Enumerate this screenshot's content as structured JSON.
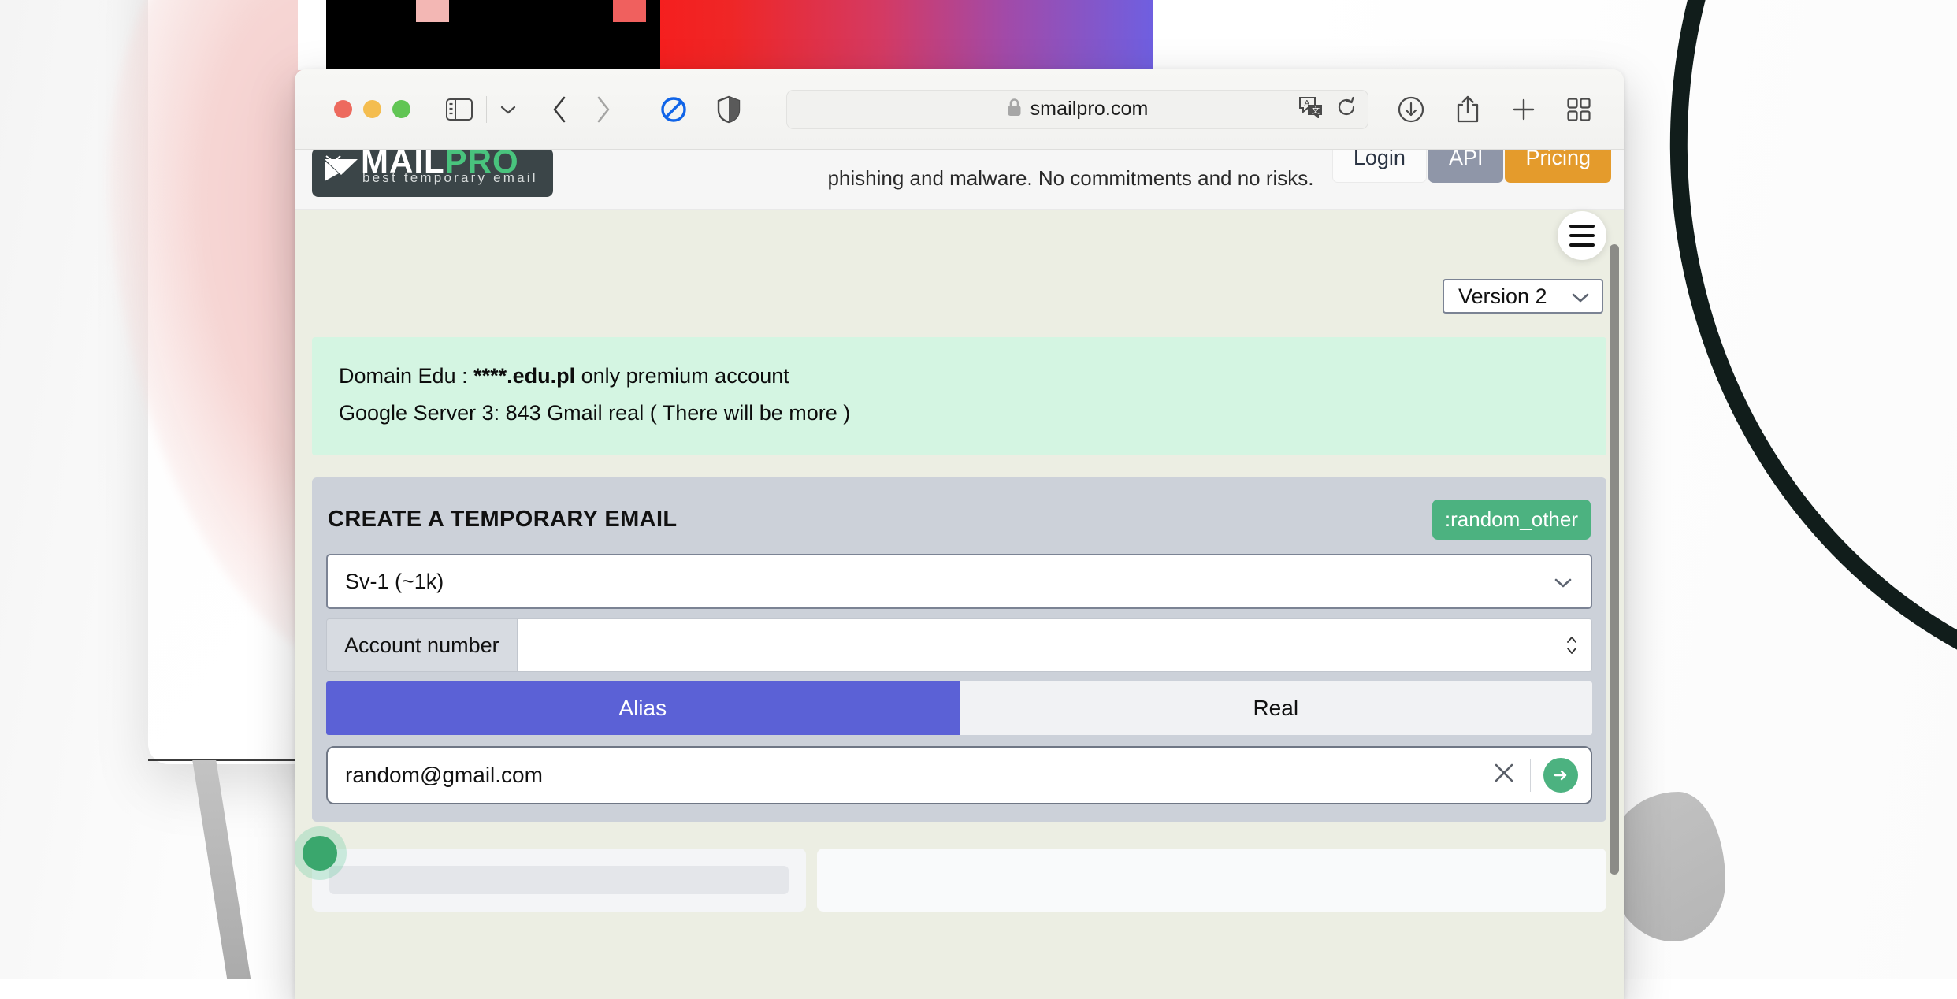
{
  "browser": {
    "window_controls": [
      "close",
      "minimize",
      "maximize"
    ],
    "sidebar_icon": "sidebar-icon",
    "tab_overview_chevron": "chevron-down-icon",
    "back_icon": "chevron-left-icon",
    "forward_icon": "chevron-right-icon",
    "content_blocker_icon": "no-entry-icon",
    "privacy_report_icon": "shield-icon",
    "url": "smailpro.com",
    "lock_icon": "lock-icon",
    "translate_icon": "translate-icon",
    "reload_icon": "reload-icon",
    "downloads_icon": "download-icon",
    "share_icon": "share-icon",
    "new_tab_icon": "plus-icon",
    "tab_group_icon": "grid-icon"
  },
  "site": {
    "logo": {
      "word_primary": "MAIL",
      "word_accent": "PRO",
      "tagline": "best temporary email"
    },
    "tagline_text": "phishing and malware. No commitments and no risks.",
    "buttons": {
      "login": "Login",
      "api": "API",
      "pricing": "Pricing"
    },
    "menu_icon": "hamburger-icon"
  },
  "version": {
    "label": "Version 2",
    "chevron": "chevron-down-icon"
  },
  "notice": {
    "line1_prefix": "Domain Edu : ",
    "line1_bold": "****.edu.pl",
    "line1_suffix": " only premium account",
    "line2": "Google Server 3: 843 Gmail real ( There will be more )"
  },
  "create_panel": {
    "title": "CREATE A TEMPORARY EMAIL",
    "badge": ":random_other",
    "server_select": {
      "value": "Sv-1 (~1k)",
      "chevron": "chevron-down-icon"
    },
    "account_number": {
      "label": "Account number",
      "value": "",
      "stepper_up": "▲",
      "stepper_down": "▼"
    },
    "tabs": [
      {
        "label": "Alias",
        "active": true
      },
      {
        "label": "Real",
        "active": false
      }
    ],
    "email": {
      "value": "random@gmail.com",
      "clear_icon": "close-icon",
      "submit_icon": "arrow-right-icon"
    }
  },
  "colors": {
    "accent_purple": "#5b61d6",
    "accent_green": "#4cb280",
    "notice_bg": "#d4f5e2",
    "panel_bg": "#ccd1d9",
    "pricing_orange": "#e49b2c",
    "api_gray": "#8f96a8"
  }
}
